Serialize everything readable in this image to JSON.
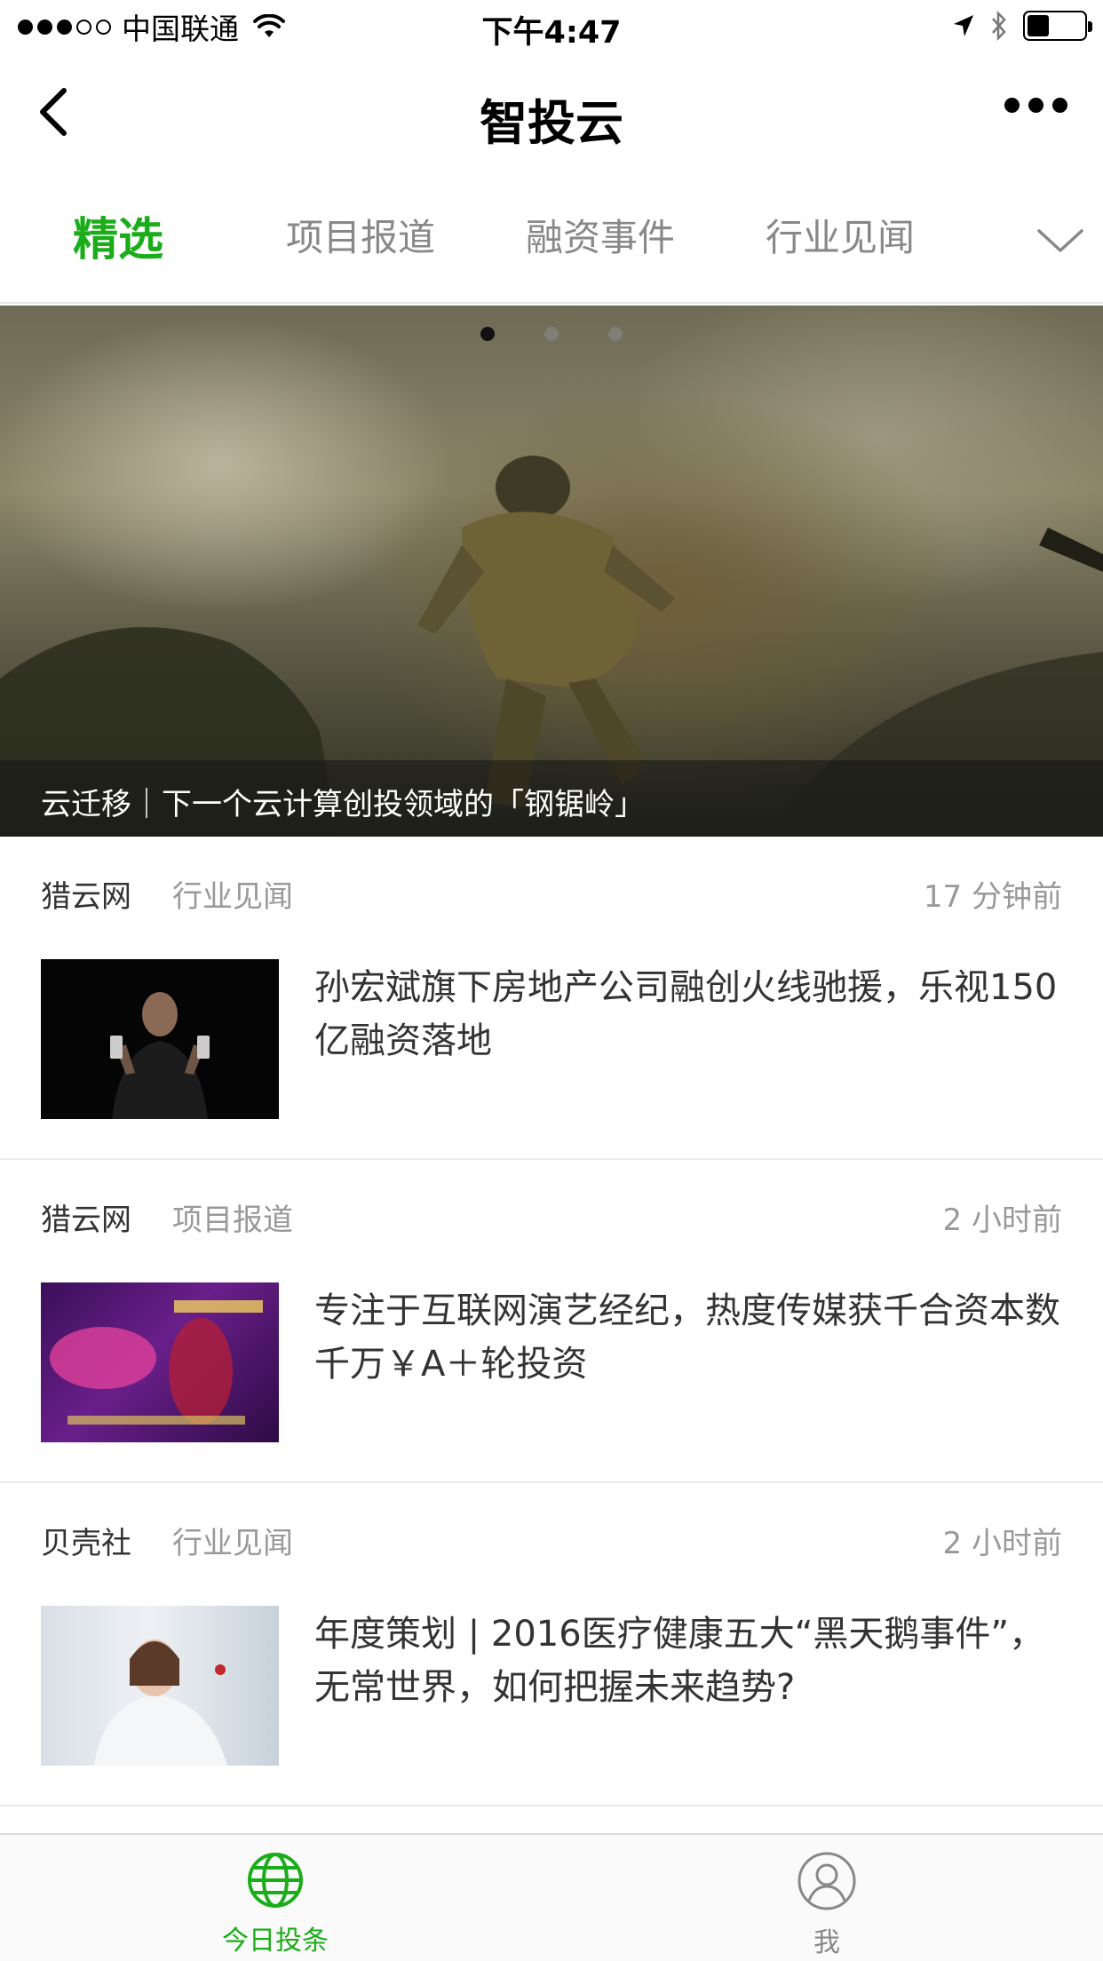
{
  "status_bar": {
    "carrier": "中国联通",
    "time": "下午4:47"
  },
  "nav": {
    "title": "智投云"
  },
  "tabs": [
    {
      "label": "精选",
      "active": true
    },
    {
      "label": "项目报道",
      "active": false
    },
    {
      "label": "融资事件",
      "active": false
    },
    {
      "label": "行业见闻",
      "active": false
    }
  ],
  "banner": {
    "caption": "云迁移｜下一个云计算创投领域的「钢锯岭」",
    "active_dot": 1,
    "dot_count": 3
  },
  "news": [
    {
      "source": "猎云网",
      "category": "行业见闻",
      "time": "17 分钟前",
      "title": "孙宏斌旗下房地产公司融创火线驰援，乐视150亿融资落地"
    },
    {
      "source": "猎云网",
      "category": "项目报道",
      "time": "2 小时前",
      "title": "专注于互联网演艺经纪，热度传媒获千合资本数千万￥A＋轮投资"
    },
    {
      "source": "贝壳社",
      "category": "行业见闻",
      "time": "2 小时前",
      "title": "年度策划 | 2016医疗健康五大“黑天鹅事件”，无常世界，如何把握未来趋势?"
    }
  ],
  "tab_bar": [
    {
      "label": "今日投条",
      "icon": "globe-icon",
      "active": true
    },
    {
      "label": "我",
      "icon": "user-icon",
      "active": false
    }
  ],
  "colors": {
    "accent": "#1aad19",
    "inactive": "#888888"
  }
}
